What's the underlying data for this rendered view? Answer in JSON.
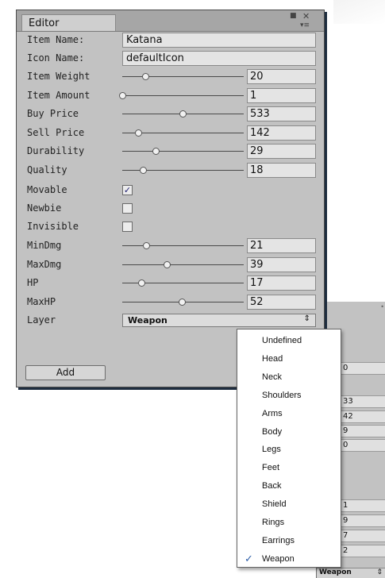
{
  "window": {
    "tab": "Editor",
    "menu_icon": "■",
    "close_icon": "✕",
    "options_icon": "▾≡"
  },
  "fields": {
    "item_name": {
      "label": "Item Name:",
      "value": "Katana"
    },
    "icon_name": {
      "label": "Icon Name:",
      "value": "defaultIcon"
    }
  },
  "sliders": [
    {
      "label": "Item Weight",
      "value": "20",
      "position": 0.2
    },
    {
      "label": "Item Amount",
      "value": "1",
      "position": 0.0
    },
    {
      "label": "Buy Price",
      "value": "533",
      "position": 0.53
    },
    {
      "label": "Sell Price",
      "value": "142",
      "position": 0.14
    },
    {
      "label": "Durability",
      "value": "29",
      "position": 0.29
    },
    {
      "label": "Quality",
      "value": "18",
      "position": 0.18
    }
  ],
  "checkboxes": [
    {
      "label": "Movable",
      "checked": true,
      "mark": "✓"
    },
    {
      "label": "Newbie",
      "checked": false,
      "mark": ""
    },
    {
      "label": "Invisible",
      "checked": false,
      "mark": ""
    }
  ],
  "sliders2": [
    {
      "label": "MinDmg",
      "value": "21",
      "position": 0.21
    },
    {
      "label": "MaxDmg",
      "value": "39",
      "position": 0.39
    },
    {
      "label": "HP",
      "value": "17",
      "position": 0.17
    },
    {
      "label": "MaxHP",
      "value": "52",
      "position": 0.52
    }
  ],
  "layer": {
    "label": "Layer",
    "value": "Weapon",
    "arrow": "⇕"
  },
  "add_button": "Add",
  "popup": {
    "items": [
      "Undefined",
      "Head",
      "Neck",
      "Shoulders",
      "Arms",
      "Body",
      "Legs",
      "Feet",
      "Back",
      "Shield",
      "Rings",
      "Earrings",
      "Weapon"
    ],
    "selected": "Weapon",
    "check_glyph": "✓"
  },
  "back_window": {
    "fields": [
      "0",
      "33",
      "42",
      "9",
      "0",
      "1",
      "9",
      "7",
      "2"
    ],
    "footer": "Weapon",
    "footer_arrow": "⇕"
  }
}
